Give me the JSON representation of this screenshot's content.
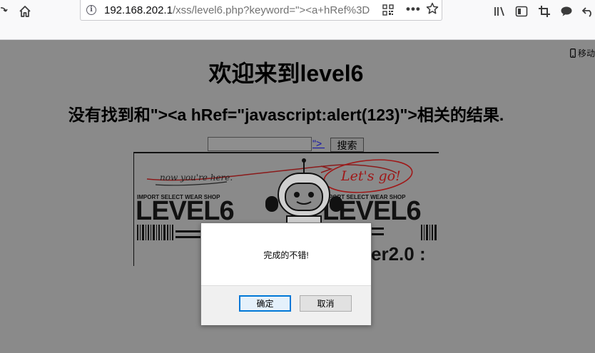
{
  "browser": {
    "url_host": "192.168.202.1",
    "url_path": "/xss/level6.php?keyword=\"><a+hRef%3D",
    "mobile_label": "移动"
  },
  "page": {
    "heading": "欢迎来到level6",
    "result_message": "没有找到和\"><a hRef=\"javascript:alert(123)\">相关的结果.",
    "search_value": "",
    "injected_link_text": "\"> ",
    "search_button": "搜索"
  },
  "banner": {
    "handwritten_left": "now you're here.",
    "handwritten_right": "Let's go!",
    "shop_text_left": "IMPORT SELECT WEAR SHOP",
    "shop_text_right": "IMPORT SELECT WEAR SHOP",
    "level_left": "LEVEL6",
    "level_right": "LEVEL6",
    "version_text": "er2.0 :"
  },
  "dialog": {
    "message": "完成的不错!",
    "ok_label": "确定",
    "cancel_label": "取消"
  }
}
